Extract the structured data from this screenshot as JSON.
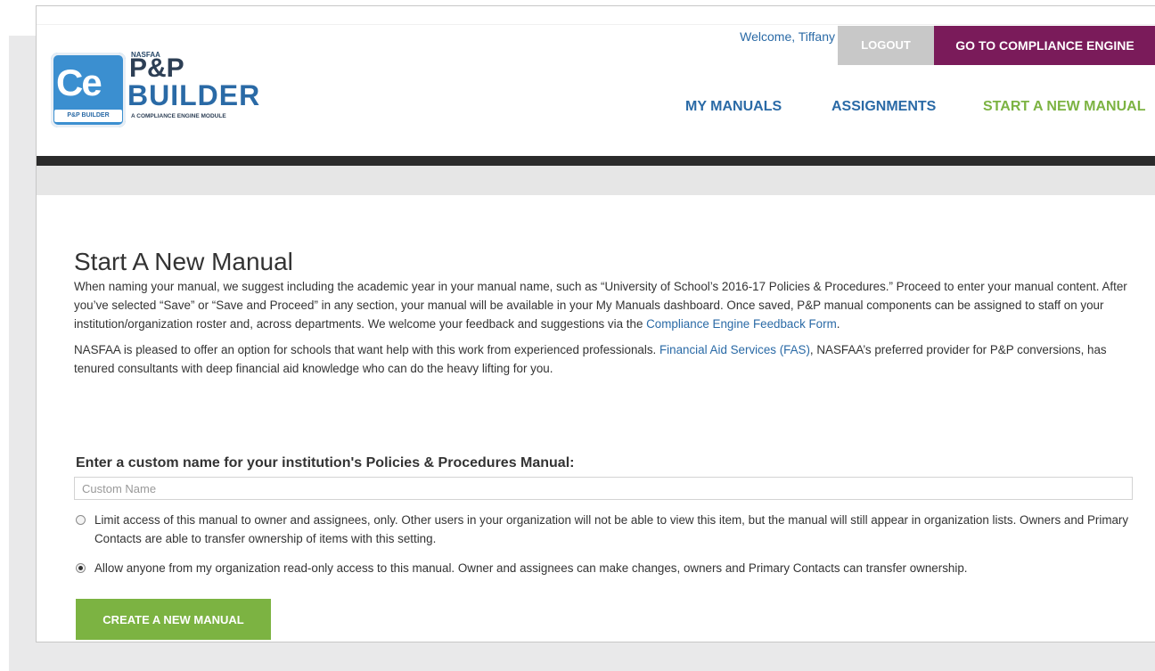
{
  "header": {
    "logo": {
      "badge_text": "Ce",
      "badge_strip": "P&P BUILDER",
      "small": "NASFAA",
      "line1": "P&P",
      "line2": "BUILDER",
      "tagline": "A COMPLIANCE ENGINE MODULE"
    },
    "welcome": "Welcome, Tiffany",
    "logout_label": "LOGOUT",
    "compliance_label": "GO TO COMPLIANCE ENGINE",
    "nav": {
      "my_manuals": "MY MANUALS",
      "assignments": "ASSIGNMENTS",
      "start_new": "START A NEW MANUAL"
    }
  },
  "main": {
    "title": "Start A New Manual",
    "intro": {
      "text": "When naming your manual, we suggest including the academic year in your manual name, such as “University of School’s 2016-17 Policies & Procedures.” Proceed to enter your manual content. After you’ve selected “Save” or “Save and Proceed” in any section, your manual will be available in your My Manuals dashboard. Once saved, P&P manual components can be assigned to staff on your institution/organization roster and, across departments. We welcome your feedback and suggestions via the ",
      "link": "Compliance Engine Feedback Form",
      "end": "."
    },
    "fas": {
      "before": "NASFAA is pleased to offer an option for schools that want help with this work from experienced professionals. ",
      "link": "Financial Aid Services (FAS)",
      "after": ", NASFAA’s preferred provider for P&P conversions, has tenured consultants with deep financial aid knowledge who can do the heavy lifting for you."
    }
  },
  "form": {
    "label": "Enter a custom name for your institution's Policies & Procedures Manual:",
    "placeholder": "Custom Name",
    "value": "",
    "option_limit": "Limit access of this manual to owner and assignees, only. Other users in your organization will not be able to view this item, but the manual will still appear in organization lists. Owners and Primary Contacts are able to transfer ownership of items with this setting.",
    "option_allow": "Allow anyone from my organization read-only access to this manual. Owner and assignees can make changes, owners and Primary Contacts can transfer ownership.",
    "selected_option": "allow",
    "submit_label": "CREATE A NEW MANUAL"
  },
  "colors": {
    "brand_blue": "#2a6aa6",
    "brand_green": "#7cb342",
    "compliance_purple": "#7a1b5a",
    "logout_gray": "#c8c8c8"
  }
}
